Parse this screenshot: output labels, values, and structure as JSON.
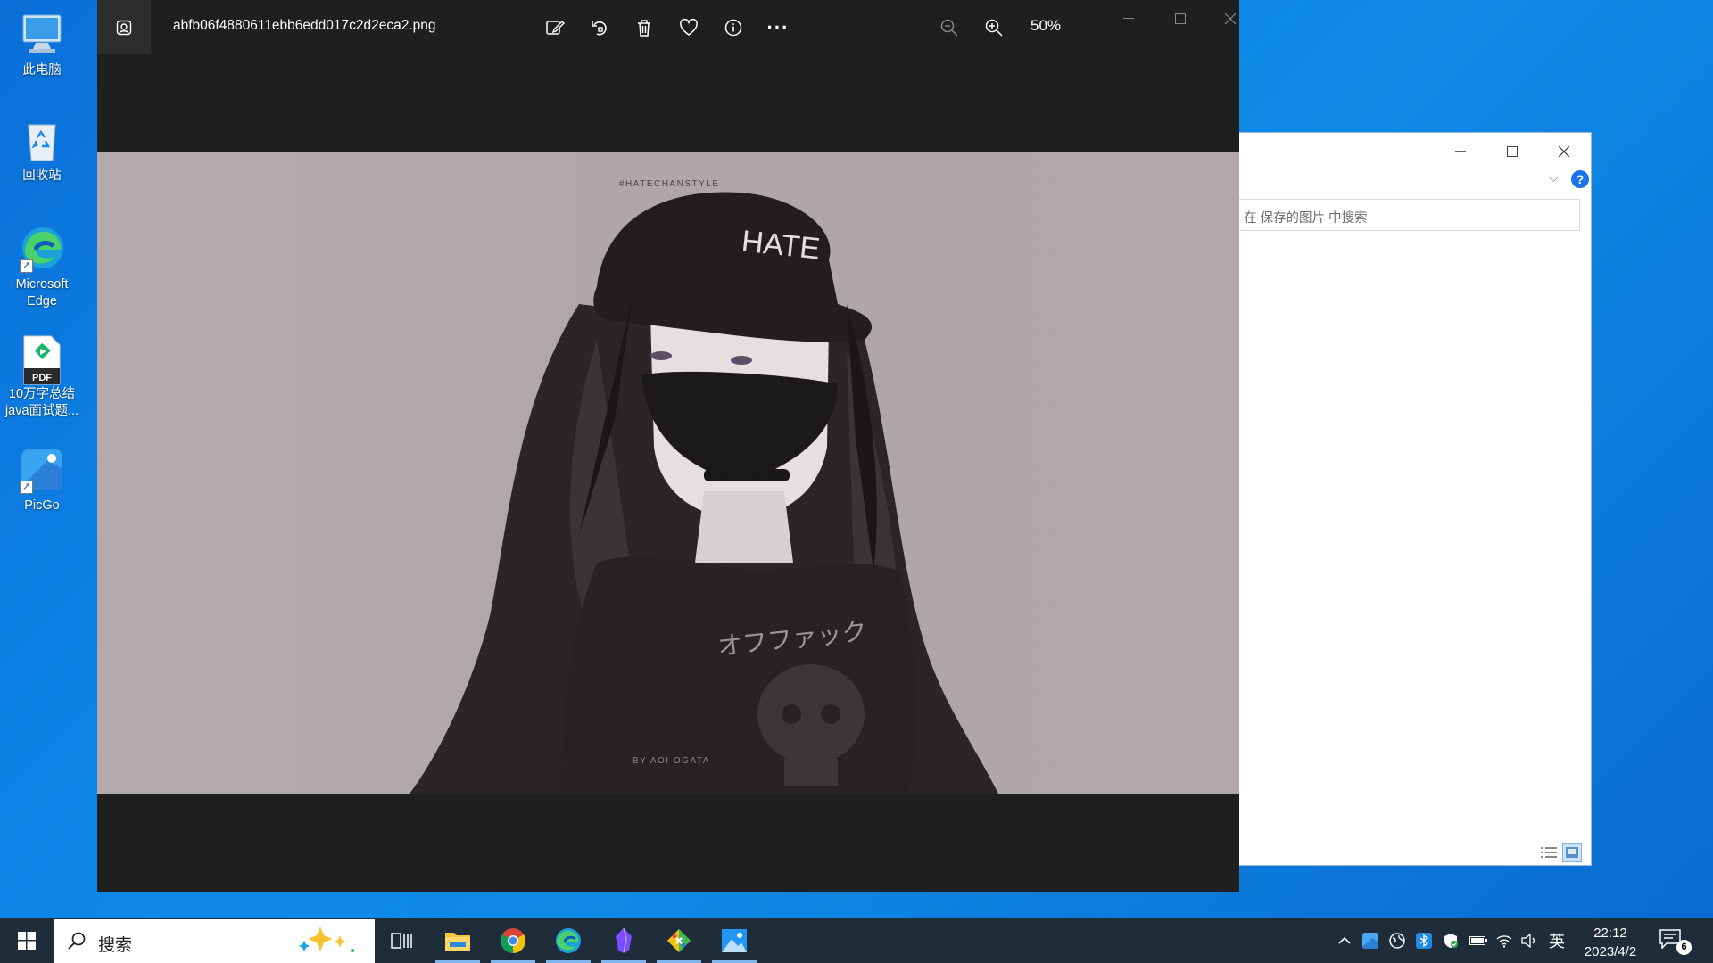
{
  "desktop": {
    "icons": [
      {
        "label": "此电脑"
      },
      {
        "label": "回收站"
      },
      {
        "label": "Microsoft Edge"
      },
      {
        "label": "10万字总结 java面试题...",
        "badge": "PDF"
      },
      {
        "label": "PicGo"
      }
    ]
  },
  "photos": {
    "title": "abfb06f4880611ebb6edd017c2d2eca2.png",
    "toolbar": [
      "edit-icon",
      "rotate-icon",
      "delete-icon",
      "favorite-icon",
      "info-icon",
      "more-icon"
    ],
    "more_label": "···",
    "zoom_level": "50%",
    "picture": {
      "hashtag": "#HATECHANSTYLE",
      "cap_text": "HATE",
      "shirt_text": "オフファック",
      "credit": "BY AOI OGATA"
    }
  },
  "explorer": {
    "search_placeholder": "在 保存的图片 中搜索",
    "help_label": "?"
  },
  "taskbar": {
    "search_label": "搜索",
    "apps": [
      "task-view",
      "file-explorer",
      "chrome",
      "edge",
      "obsidian",
      "git",
      "photos"
    ],
    "tray": {
      "ime": "英"
    },
    "clock": {
      "time": "22:12",
      "date": "2023/4/2"
    },
    "notifications": "6"
  },
  "colors": {
    "accent": "#0078d4",
    "desktop": "#0d86e8",
    "taskbar": "#1f2d3a",
    "viewer_bg": "#1f1f1f"
  }
}
